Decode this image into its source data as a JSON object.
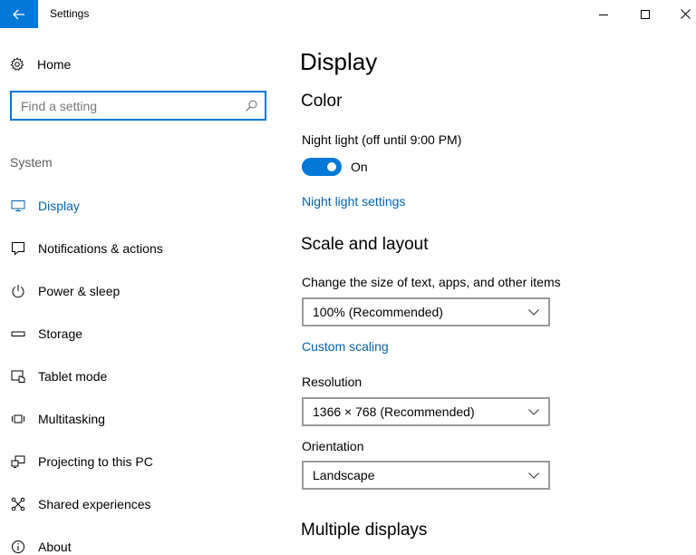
{
  "window": {
    "title": "Settings"
  },
  "sidebar": {
    "home_label": "Home",
    "search_placeholder": "Find a setting",
    "section_label": "System",
    "items": [
      {
        "label": "Display",
        "icon": "monitor-icon",
        "active": true
      },
      {
        "label": "Notifications & actions",
        "icon": "notification-icon",
        "active": false
      },
      {
        "label": "Power & sleep",
        "icon": "power-icon",
        "active": false
      },
      {
        "label": "Storage",
        "icon": "storage-icon",
        "active": false
      },
      {
        "label": "Tablet mode",
        "icon": "tablet-mode-icon",
        "active": false
      },
      {
        "label": "Multitasking",
        "icon": "multitasking-icon",
        "active": false
      },
      {
        "label": "Projecting to this PC",
        "icon": "projecting-icon",
        "active": false
      },
      {
        "label": "Shared experiences",
        "icon": "shared-experiences-icon",
        "active": false
      },
      {
        "label": "About",
        "icon": "info-icon",
        "active": false
      }
    ]
  },
  "main": {
    "page_title": "Display",
    "color": {
      "header": "Color",
      "night_light_label": "Night light (off until 9:00 PM)",
      "toggle_state": "On",
      "night_light_link": "Night light settings"
    },
    "scale": {
      "header": "Scale and layout",
      "size_label": "Change the size of text, apps, and other items",
      "size_value": "100% (Recommended)",
      "custom_link": "Custom scaling",
      "resolution_label": "Resolution",
      "resolution_value": "1366 × 768 (Recommended)",
      "orientation_label": "Orientation",
      "orientation_value": "Landscape"
    },
    "multiple_displays_header": "Multiple displays"
  },
  "colors": {
    "accent": "#0078d7",
    "link": "#0063b1",
    "section_label": "#5c5c5c"
  }
}
